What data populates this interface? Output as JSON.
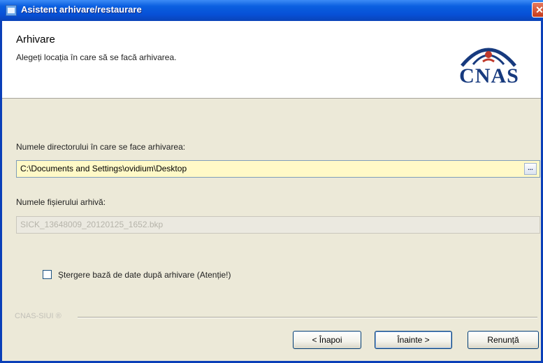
{
  "window": {
    "title": "Asistent arhivare/restaurare"
  },
  "header": {
    "title": "Arhivare",
    "subtitle": "Alegeți locația în care să se facă arhivarea.",
    "logo_text": "CNAS"
  },
  "form": {
    "dir_label": "Numele directorului în care se face arhivarea:",
    "dir_value": "C:\\Documents and Settings\\ovidium\\Desktop",
    "browse_label": "...",
    "file_label": "Numele fișierului arhivă:",
    "file_value": "SICK_13648009_20120125_1652.bkp",
    "checkbox_label": "Ștergere bază de date după arhivare (Atenție!)",
    "checkbox_checked": false
  },
  "footer": {
    "group_label": "CNAS-SIUI ®",
    "back_label": "< Înapoi",
    "next_label": "Înainte >",
    "cancel_label": "Renunță"
  },
  "colors": {
    "titlebar": "#0750d6",
    "dialog_bg": "#ece9d8",
    "active_input_bg": "#fff9c7",
    "logo_blue": "#173a7e",
    "logo_red": "#c0392b"
  }
}
